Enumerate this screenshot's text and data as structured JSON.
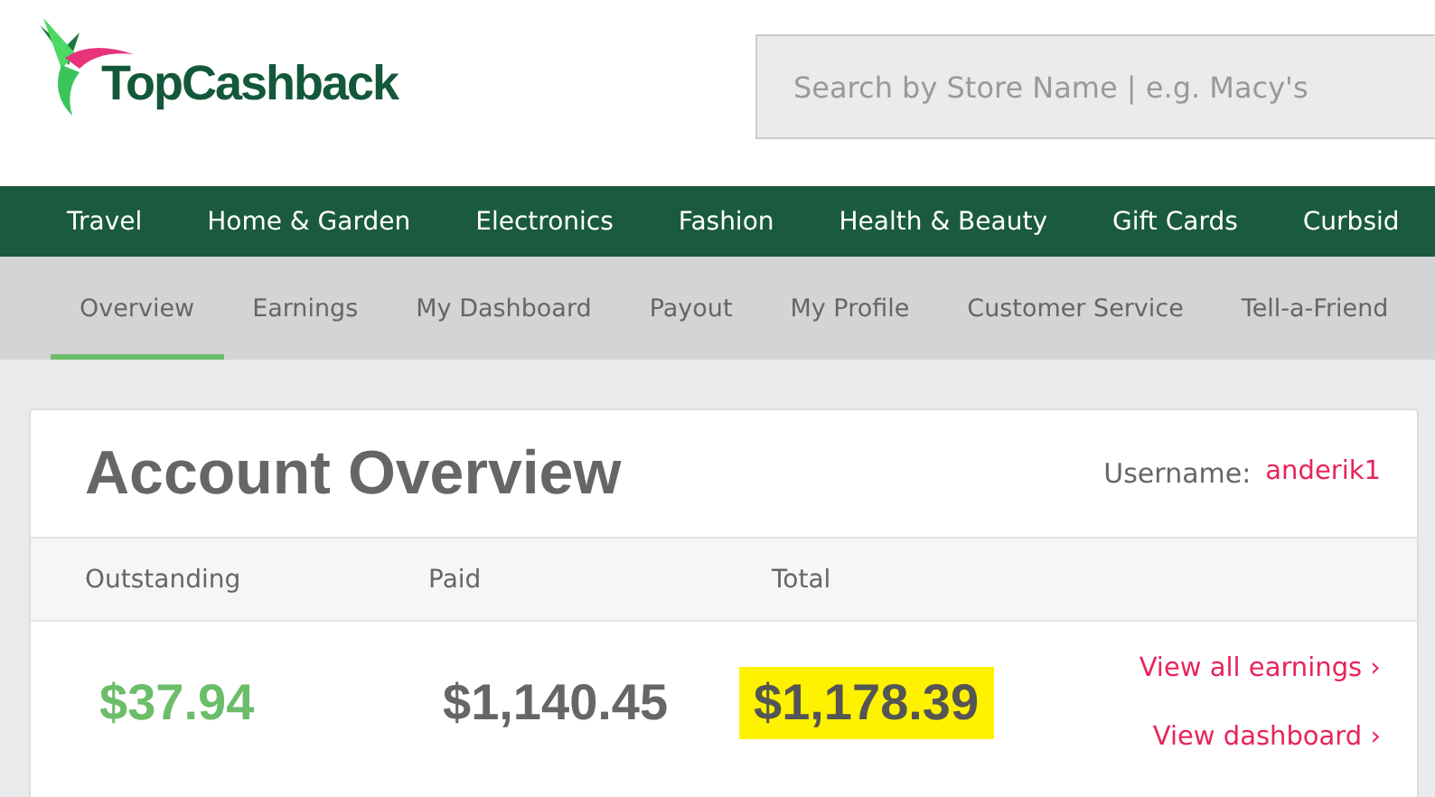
{
  "header": {
    "logo_text": "TopCashback",
    "search": {
      "placeholder": "Search by Store Name | e.g. Macy's"
    }
  },
  "main_nav": [
    "Travel",
    "Home & Garden",
    "Electronics",
    "Fashion",
    "Health & Beauty",
    "Gift Cards",
    "Curbsid"
  ],
  "sub_nav": [
    {
      "label": "Overview",
      "selected": true
    },
    {
      "label": "Earnings",
      "selected": false
    },
    {
      "label": "My Dashboard",
      "selected": false
    },
    {
      "label": "Payout",
      "selected": false
    },
    {
      "label": "My Profile",
      "selected": false
    },
    {
      "label": "Customer Service",
      "selected": false
    },
    {
      "label": "Tell-a-Friend",
      "selected": false
    }
  ],
  "account": {
    "title": "Account Overview",
    "username_label": "Username:",
    "username": "anderik1",
    "columns": [
      {
        "label": "Outstanding",
        "amount": "$37.94",
        "color": "#6cbd6a",
        "highlighted": false
      },
      {
        "label": "Paid",
        "amount": "$1,140.45",
        "color": "#666666",
        "highlighted": false
      },
      {
        "label": "Total",
        "amount": "$1,178.39",
        "color": "#555555",
        "highlighted": true
      }
    ],
    "links": [
      "View all earnings ›",
      "View dashboard ›"
    ]
  }
}
